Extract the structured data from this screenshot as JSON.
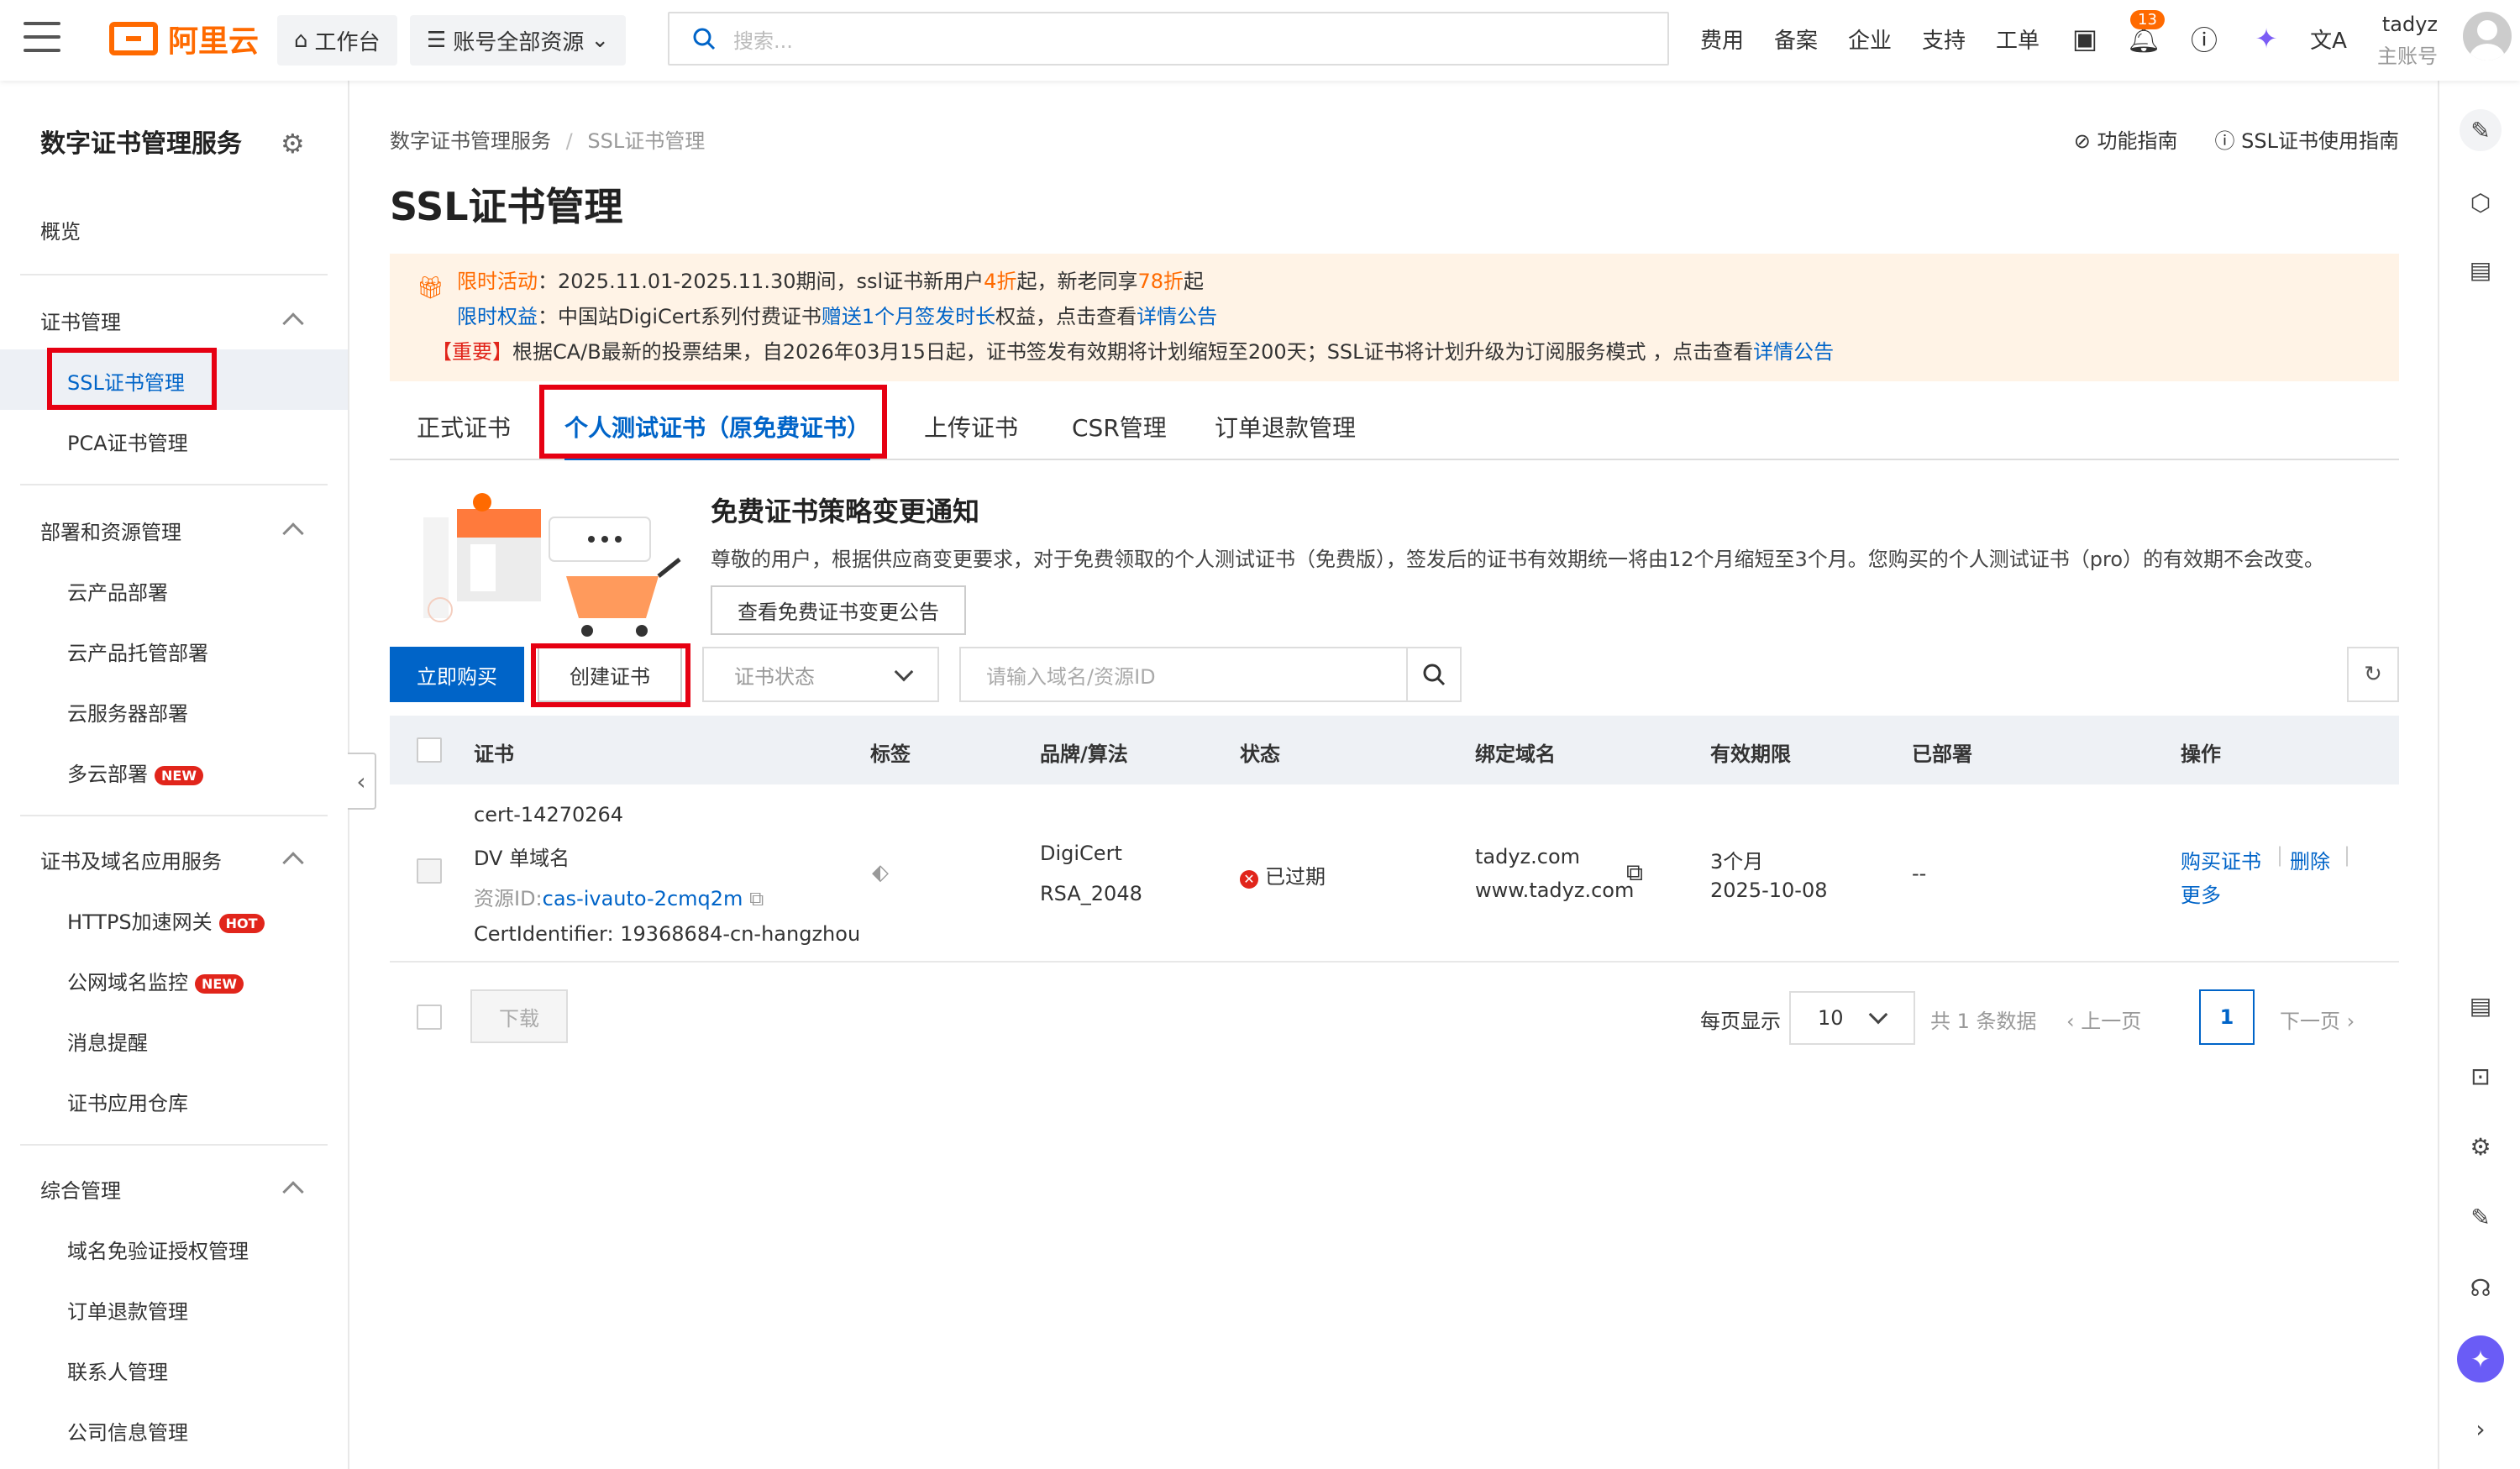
{
  "topbar": {
    "brand": "阿里云",
    "workbench": "工作台",
    "resources": "账号全部资源",
    "search_placeholder": "搜索...",
    "nav": [
      "费用",
      "备案",
      "企业",
      "支持",
      "工单"
    ],
    "notification_count": "13",
    "user_name": "tadyz",
    "user_role": "主账号"
  },
  "sidebar": {
    "title": "数字证书管理服务",
    "overview": "概览",
    "groups": [
      {
        "label": "证书管理",
        "items": [
          "SSL证书管理",
          "PCA证书管理"
        ]
      },
      {
        "label": "部署和资源管理",
        "items": [
          "云产品部署",
          "云产品托管部署",
          "云服务器部署",
          "多云部署"
        ]
      },
      {
        "label": "证书及域名应用服务",
        "items": [
          "HTTPS加速网关",
          "公网域名监控",
          "消息提醒",
          "证书应用仓库"
        ]
      },
      {
        "label": "综合管理",
        "items": [
          "域名免验证授权管理",
          "订单退款管理",
          "联系人管理",
          "公司信息管理"
        ]
      }
    ],
    "tag_new": "NEW",
    "tag_hot": "HOT"
  },
  "main": {
    "breadcrumb": [
      "数字证书管理服务",
      "SSL证书管理"
    ],
    "breadcrumb_sep": "/",
    "guides": [
      "功能指南",
      "SSL证书使用指南"
    ],
    "title": "SSL证书管理",
    "notice": {
      "l1_a": "限时活动",
      "l1_b": "：2025.11.01-2025.11.30期间，ssl证书新用户",
      "l1_c": "4折",
      "l1_d": "起，新老同享",
      "l1_e": "78折",
      "l1_f": "起",
      "l2_a": "限时权益",
      "l2_b": "：中国站DigiCert系列付费证书",
      "l2_c": "赠送1个月签发时长",
      "l2_d": "权益，点击查看",
      "l2_e": "详情公告",
      "l3_a": "【重要】",
      "l3_b": "根据CA/B最新的投票结果，自2026年03月15日起，证书签发有效期将计划缩短至200天；SSL证书将计划升级为订阅服务模式 ，点击查看",
      "l3_c": "详情公告"
    },
    "tabs": [
      "正式证书",
      "个人测试证书（原免费证书）",
      "上传证书",
      "CSR管理",
      "订单退款管理"
    ],
    "promo": {
      "title": "免费证书策略变更通知",
      "text": "尊敬的用户，根据供应商变更要求，对于免费领取的个人测试证书（免费版），签发后的证书有效期统一将由12个月缩短至3个月。您购买的个人测试证书（pro）的有效期不会改变。",
      "button": "查看免费证书变更公告"
    },
    "toolbar": {
      "buy": "立即购买",
      "create": "创建证书",
      "status_placeholder": "证书状态",
      "search_placeholder": "请输入域名/资源ID"
    },
    "table": {
      "headers": [
        "证书",
        "标签",
        "品牌/算法",
        "状态",
        "绑定域名",
        "有效期限",
        "已部署",
        "操作"
      ],
      "row": {
        "name": "cert-14270264",
        "type": "DV 单域名",
        "resource_label": "资源ID:",
        "resource_id": "cas-ivauto-2cmq2m",
        "identifier": "CertIdentifier: 19368684-cn-hangzhou",
        "brand": "DigiCert",
        "algo": "RSA_2048",
        "status": "已过期",
        "domain1": "tadyz.com",
        "domain2": "www.tadyz.com",
        "validity": "3个月",
        "expiry": "2025-10-08",
        "deployed": "--",
        "actions": [
          "购买证书",
          "删除",
          "更多"
        ]
      }
    },
    "pager": {
      "download": "下载",
      "page_size_label": "每页显示",
      "page_size": "10",
      "total": "共 1 条数据",
      "prev": "上一页",
      "current": "1",
      "next": "下一页"
    }
  },
  "colors": {
    "accent": "#0064c8",
    "brand": "#ff6a00",
    "highlight": "#e60012"
  }
}
